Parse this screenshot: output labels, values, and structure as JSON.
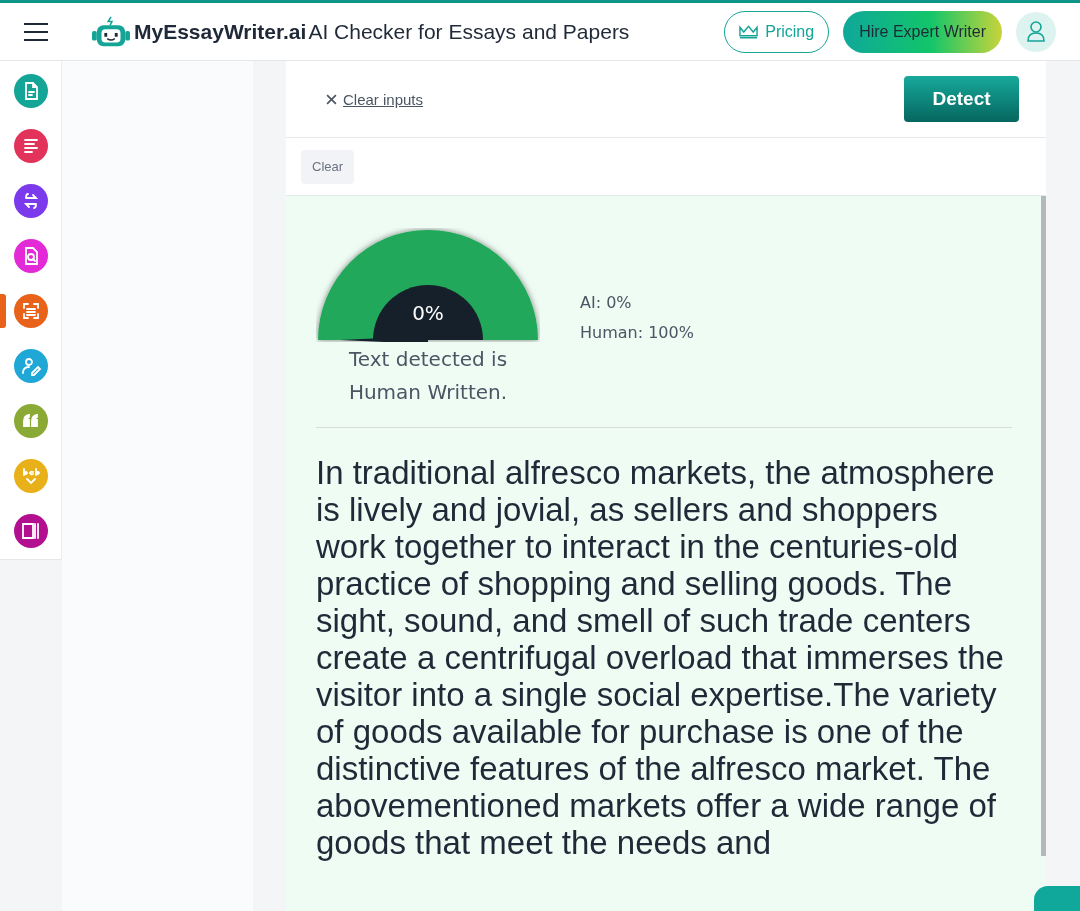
{
  "header": {
    "logo": "MyEssayWriter.ai",
    "title": "AI Checker for Essays and Papers",
    "pricing": "Pricing",
    "hire": "Hire Expert Writer"
  },
  "sidebar": {
    "items": [
      {
        "kind": "document",
        "color": "#14a596",
        "selected": false
      },
      {
        "kind": "lines",
        "color": "#e2335a",
        "selected": false
      },
      {
        "kind": "swap",
        "color": "#7c3aed",
        "selected": false
      },
      {
        "kind": "search-doc",
        "color": "#e22bd6",
        "selected": false
      },
      {
        "kind": "scan",
        "color": "#e8621a",
        "selected": true
      },
      {
        "kind": "user-edit",
        "color": "#1fa7d6",
        "selected": false
      },
      {
        "kind": "quote",
        "color": "#8aaa35",
        "selected": false
      },
      {
        "kind": "abc",
        "color": "#e8b019",
        "selected": false
      },
      {
        "kind": "pages",
        "color": "#b3108f",
        "selected": false
      }
    ]
  },
  "toolbar": {
    "clear_inputs": "Clear inputs",
    "detect": "Detect",
    "clear": "Clear"
  },
  "result": {
    "gauge": {
      "reading": "0%"
    },
    "verdict": "Text detected is Human Written.",
    "ai": "AI: 0%",
    "human": "Human: 100%",
    "text": "In traditional alfresco markets, the atmosphere is lively and jovial, as sellers and shoppers work together to interact in the centuries-old practice of shopping and selling goods. The sight, sound, and smell of such trade centers create a centrifugal overload that immerses the visitor into a single social expertise.The variety of goods available for purchase is one of the distinctive features of the alfresco market. The abovementioned markets offer a wide range of goods that meet the needs and"
  }
}
